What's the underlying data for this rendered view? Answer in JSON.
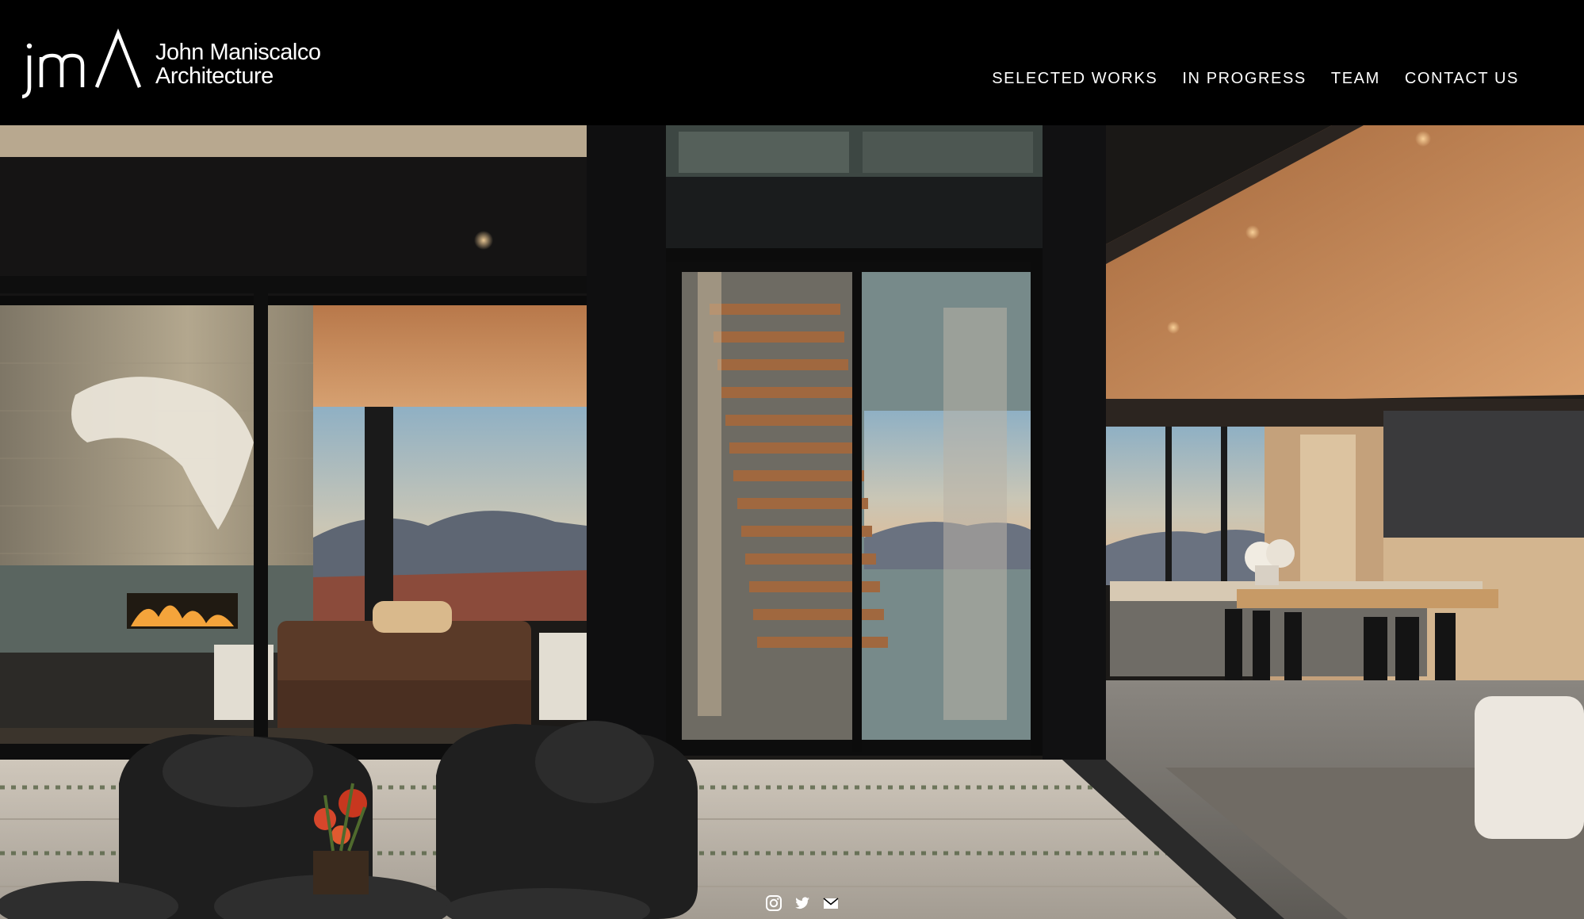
{
  "brand": {
    "name_line1": "John Maniscalco",
    "name_line2": "Architecture",
    "logo_icon": "jma-logo-mark"
  },
  "nav": {
    "items": [
      {
        "label": "SELECTED WORKS"
      },
      {
        "label": "IN PROGRESS"
      },
      {
        "label": "TEAM"
      },
      {
        "label": "CONTACT US"
      }
    ]
  },
  "hero": {
    "image_icon": "hero-photo"
  },
  "social": {
    "icons": [
      "instagram-icon",
      "twitter-icon",
      "email-icon"
    ]
  },
  "colors": {
    "header_bg": "#000000",
    "nav_text": "#ffffff"
  }
}
